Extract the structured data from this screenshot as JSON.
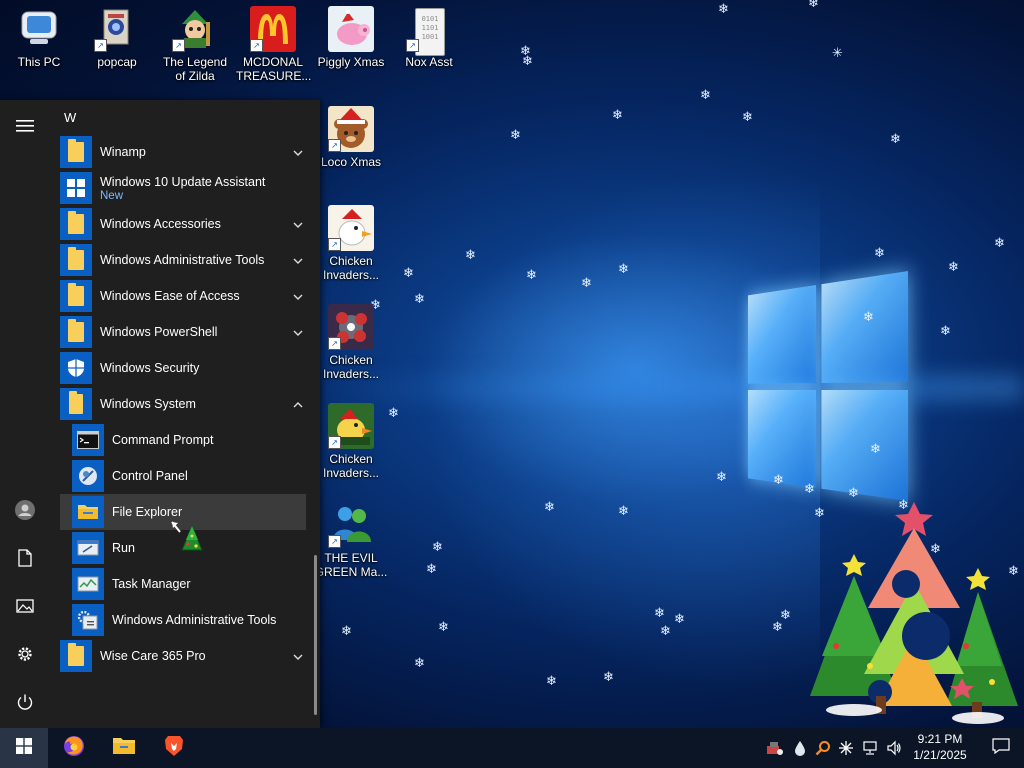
{
  "desktop": {
    "icons": [
      {
        "label": "This PC"
      },
      {
        "label": "popcap"
      },
      {
        "label": "The Legend of Zilda"
      },
      {
        "label": "MCDONAL TREASURE..."
      },
      {
        "label": "Piggly Xmas"
      },
      {
        "label": "Nox Asst"
      },
      {
        "label": "Loco Xmas"
      },
      {
        "label": "Chicken Invaders..."
      },
      {
        "label": "Chicken Invaders..."
      },
      {
        "label": "Chicken Invaders..."
      },
      {
        "label": "THE EVIL GREEN Ma..."
      }
    ],
    "nox_file_text": "0101 1101 1001"
  },
  "start_menu": {
    "group_letter": "W",
    "apps": [
      {
        "name": "Winamp"
      },
      {
        "name": "Windows 10 Update Assistant",
        "badge": "New"
      },
      {
        "name": "Windows Accessories"
      },
      {
        "name": "Windows Administrative Tools"
      },
      {
        "name": "Windows Ease of Access"
      },
      {
        "name": "Windows PowerShell"
      },
      {
        "name": "Windows Security"
      },
      {
        "name": "Windows System"
      },
      {
        "name": "Command Prompt"
      },
      {
        "name": "Control Panel"
      },
      {
        "name": "File Explorer"
      },
      {
        "name": "Run"
      },
      {
        "name": "Task Manager"
      },
      {
        "name": "Windows Administrative Tools"
      },
      {
        "name": "Wise Care 365 Pro"
      }
    ],
    "colors": {
      "tile_blue": "#0a5fc2",
      "folder_yellow": "#f7cf5a",
      "hover": "#3b3b3b",
      "badge": "#7ab8ff"
    }
  },
  "taskbar": {
    "clock_time": "9:21 PM",
    "clock_date": "1/21/2025"
  }
}
